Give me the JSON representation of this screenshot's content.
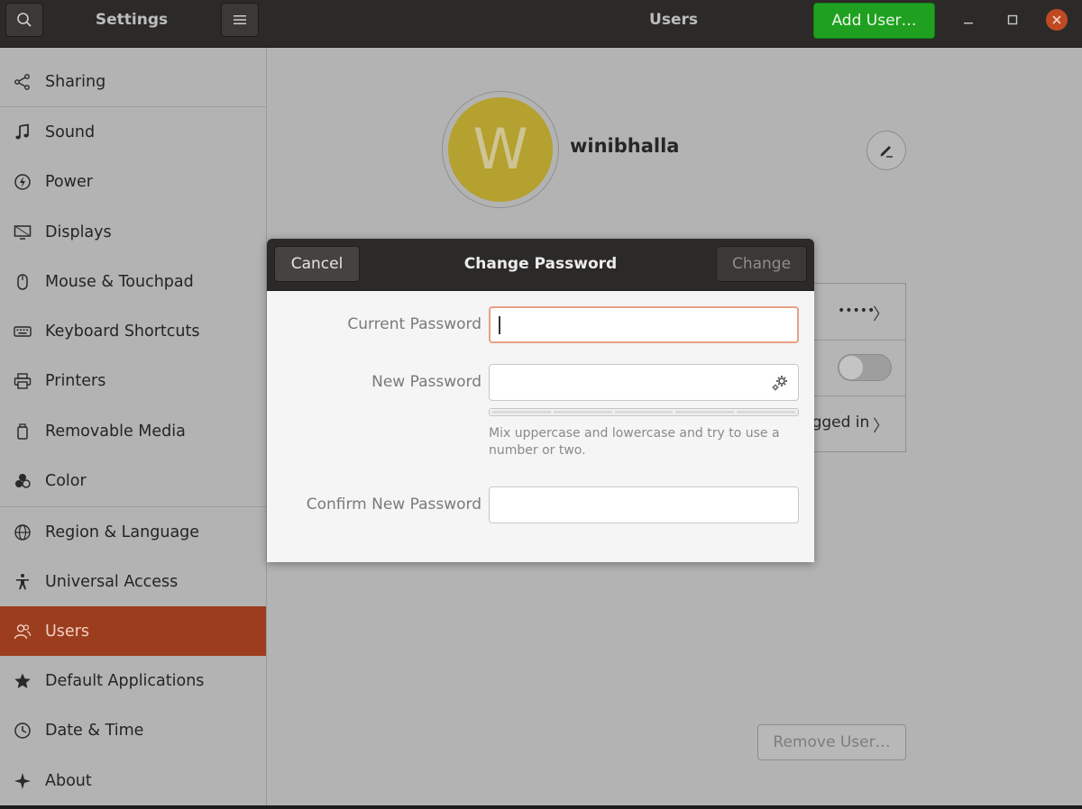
{
  "header": {
    "search_icon": "search-icon",
    "app_title": "Settings",
    "menu_icon": "hamburger-menu-icon",
    "panel_title": "Users",
    "add_user_label": "Add User…",
    "add_user_color": "#20a020"
  },
  "sidebar": {
    "items": [
      {
        "label": "Sharing",
        "icon": "share-icon"
      },
      {
        "label": "Sound",
        "icon": "music-note-icon"
      },
      {
        "label": "Power",
        "icon": "power-icon"
      },
      {
        "label": "Displays",
        "icon": "display-icon"
      },
      {
        "label": "Mouse & Touchpad",
        "icon": "mouse-icon"
      },
      {
        "label": "Keyboard Shortcuts",
        "icon": "keyboard-icon"
      },
      {
        "label": "Printers",
        "icon": "printer-icon"
      },
      {
        "label": "Removable Media",
        "icon": "removable-media-icon"
      },
      {
        "label": "Color",
        "icon": "color-icon"
      },
      {
        "label": "Region & Language",
        "icon": "globe-icon"
      },
      {
        "label": "Universal Access",
        "icon": "accessibility-icon"
      },
      {
        "label": "Users",
        "icon": "users-icon",
        "active": true
      },
      {
        "label": "Default Applications",
        "icon": "star-icon"
      },
      {
        "label": "Date & Time",
        "icon": "clock-icon"
      },
      {
        "label": "About",
        "icon": "sparkle-icon"
      }
    ],
    "active_color": "#9c3d1d"
  },
  "user": {
    "avatar_initial": "W",
    "avatar_color": "#b4a12f",
    "username": "winibhalla",
    "password_dots": "•••••",
    "logged_in_text": "Logged in",
    "remove_label": "Remove User…"
  },
  "dialog": {
    "title": "Change Password",
    "cancel_label": "Cancel",
    "change_label": "Change",
    "current_password_label": "Current Password",
    "current_password_value": "",
    "new_password_label": "New Password",
    "new_password_value": "",
    "hint": "Mix uppercase and lowercase and try to use a number or two.",
    "confirm_password_label": "Confirm New Password",
    "confirm_password_value": "",
    "focus_color": "#e8a085"
  }
}
